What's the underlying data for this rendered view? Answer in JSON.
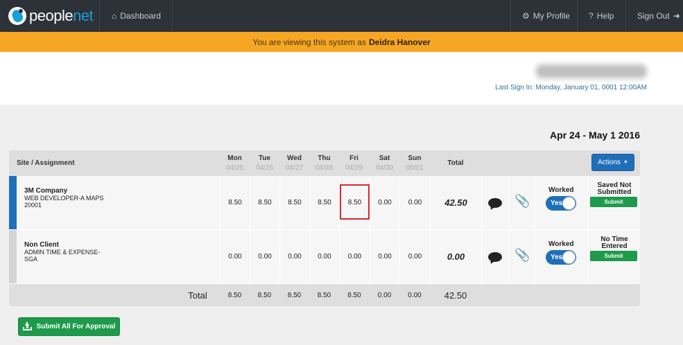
{
  "nav": {
    "logo_left": "people",
    "logo_right": "net",
    "dashboard": "Dashboard",
    "my_profile": "My Profile",
    "help": "Help",
    "sign_out": "Sign Out"
  },
  "banner": {
    "prefix": "You are viewing this system as",
    "name": "Deidra Hanover"
  },
  "header": {
    "last_sign_in": "Last Sign In: Monday, January 01, 0001 12:00AM"
  },
  "week_range": "Apr 24 - May 1 2016",
  "table": {
    "col_site": "Site / Assignment",
    "days": [
      {
        "name": "Mon",
        "date": "04/25"
      },
      {
        "name": "Tue",
        "date": "04/26"
      },
      {
        "name": "Wed",
        "date": "04/27"
      },
      {
        "name": "Thu",
        "date": "04/28"
      },
      {
        "name": "Fri",
        "date": "04/29"
      },
      {
        "name": "Sat",
        "date": "04/30"
      },
      {
        "name": "Sun",
        "date": "05/01"
      }
    ],
    "col_total": "Total",
    "actions_label": "Actions",
    "rows": [
      {
        "company": "3M Company",
        "line1": "WEB DEVELOPER-A MAPS",
        "line2": "20001",
        "hours": [
          "8.50",
          "8.50",
          "8.50",
          "8.50",
          "8.50",
          "0.00",
          "0.00"
        ],
        "total": "42.50",
        "worked_label": "Worked",
        "toggle": "Yes",
        "status": "Saved Not Submitted",
        "submit": "Submit",
        "bar_color": "#1f6fb8"
      },
      {
        "company": "Non Client",
        "line1": "ADMIN TIME & EXPENSE-",
        "line2": "SGA",
        "hours": [
          "0.00",
          "0.00",
          "0.00",
          "0.00",
          "0.00",
          "0.00",
          "0.00"
        ],
        "total": "0.00",
        "worked_label": "Worked",
        "toggle": "Yes",
        "status": "No Time Entered",
        "submit": "Submit",
        "bar_color": "#d4d4d4"
      }
    ],
    "footer": {
      "label": "Total",
      "hours": [
        "8.50",
        "8.50",
        "8.50",
        "8.50",
        "8.50",
        "0.00",
        "0.00"
      ],
      "total": "42.50"
    }
  },
  "submit_all": "Submit All For Approval"
}
